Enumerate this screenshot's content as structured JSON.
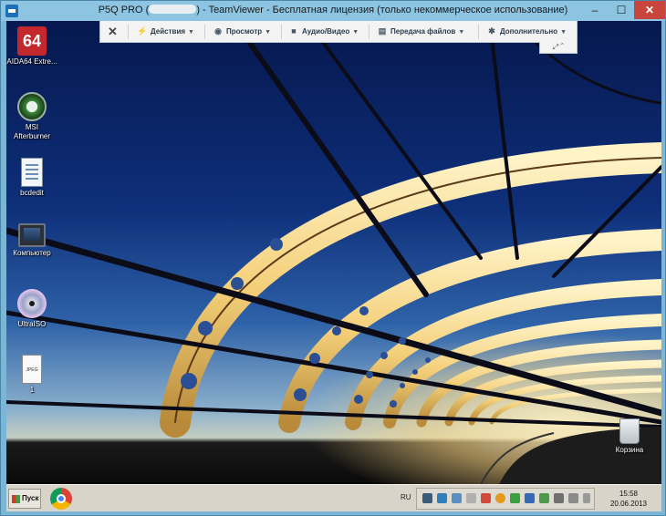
{
  "window": {
    "title_prefix": "P5Q PRO (",
    "title_suffix": ") - TeamViewer - Бесплатная лицензия (только некоммерческое использование)",
    "minimize_glyph": "–",
    "maximize_glyph": "☐",
    "close_glyph": "✕"
  },
  "toolbar": {
    "close_glyph": "✕",
    "actions_label": "Действия",
    "view_label": "Просмотр",
    "audio_video_label": "Аудио/Видео",
    "file_transfer_label": "Передача файлов",
    "extras_label": "Дополнительно",
    "dropdown_glyph": "▼",
    "collapse_glyph": "⌃",
    "fullscreen_glyph": "⤢"
  },
  "desktop_icons": [
    {
      "label": "AIDA64 Extre...",
      "icon": "aida64-icon"
    },
    {
      "label": "MSI Afterburner",
      "icon": "afterburner-icon"
    },
    {
      "label": "bcdedit",
      "icon": "document-icon"
    },
    {
      "label": "Компьютер",
      "icon": "computer-icon"
    },
    {
      "label": "UltraISO",
      "icon": "disc-icon"
    },
    {
      "label": "1",
      "icon": "jpeg-file-icon"
    },
    {
      "label": "Корзина",
      "icon": "recycle-bin-icon"
    }
  ],
  "aida_badge": "64",
  "jpeg_badge": "JPEG",
  "taskbar": {
    "start_label": "Пуск",
    "language": "RU",
    "time": "15:58",
    "date": "20.06.2013"
  },
  "colors": {
    "close_red": "#c7453d",
    "taskbar": "#d8d4c9",
    "titlebar": "#8cc4e2"
  }
}
